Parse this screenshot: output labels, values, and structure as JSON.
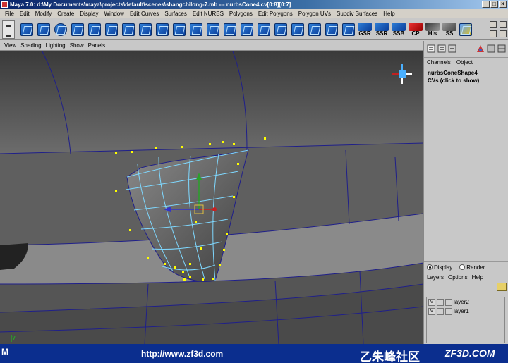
{
  "window": {
    "title": "Maya 7.0: d:\\My Documents\\maya\\projects\\default\\scenes\\shangchilong-7.mb  ---  nurbsCone4.cv[0:8][0:7]",
    "minimize": "_",
    "maximize": "□",
    "close": "×"
  },
  "menubar": [
    "File",
    "Edit",
    "Modify",
    "Create",
    "Display",
    "Window",
    "Edit Curves",
    "Surfaces",
    "Edit NURBS",
    "Polygons",
    "Edit Polygons",
    "Polygon UVs",
    "Subdiv Surfaces",
    "Help"
  ],
  "shelf": {
    "text_buttons": [
      "GSR",
      "SSR",
      "SSB",
      "CP",
      "His",
      "SS"
    ]
  },
  "viewport_menu": [
    "View",
    "Shading",
    "Lighting",
    "Show",
    "Panels"
  ],
  "viewport": {
    "axis_label": "y",
    "colors": {
      "background": "#6e6e6e",
      "surface": "#5a5a5a",
      "wire": "#1a1a8a",
      "cv_wire": "#7fd8ff",
      "cv_point": "#ffff00"
    }
  },
  "channel_box": {
    "tabs": [
      "Channels",
      "Object"
    ],
    "object_name": "nurbsConeShape4",
    "cvs_hint": "CVs (click to show)"
  },
  "layer_editor": {
    "display_label": "Display",
    "render_label": "Render",
    "menu": [
      "Layers",
      "Options",
      "Help"
    ],
    "layers": [
      {
        "visible": "V",
        "name": "layer2"
      },
      {
        "visible": "V",
        "name": "layer1"
      }
    ]
  },
  "footer": {
    "left_mark": "M",
    "url": "http://www.zf3d.com",
    "cn_logo": "乙朱峰社区",
    "site": "ZF3D.COM"
  }
}
